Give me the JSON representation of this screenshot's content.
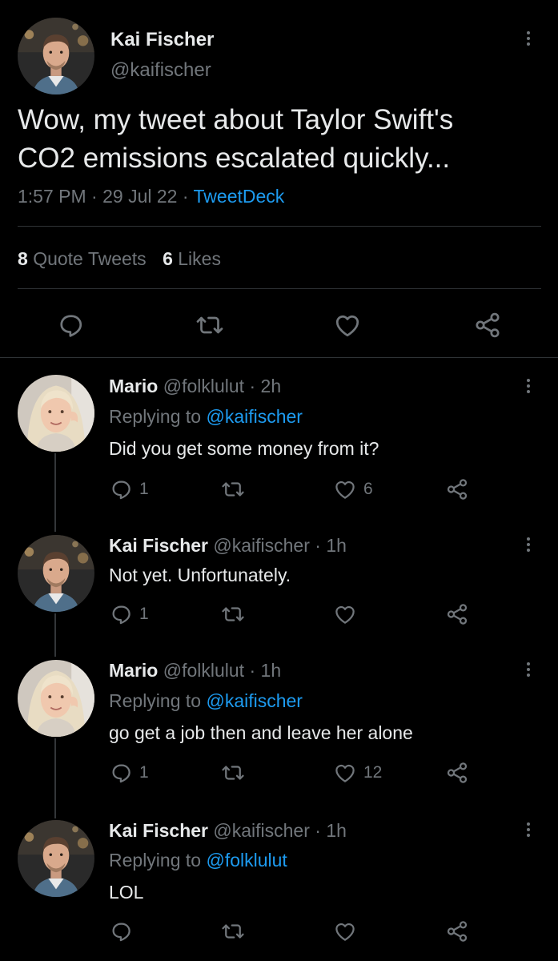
{
  "main_tweet": {
    "author_name": "Kai Fischer",
    "author_handle": "@kaifischer",
    "text_line1": "Wow, my tweet about Taylor Swift's",
    "text_line2": "CO2 emissions escalated quickly...",
    "time": "1:57 PM",
    "date": "29 Jul 22",
    "source": "TweetDeck",
    "quote_count": "8",
    "quote_label": "Quote Tweets",
    "like_count": "6",
    "like_label": "Likes"
  },
  "replies": [
    {
      "name": "Mario",
      "handle": "@folklulut",
      "time": "2h",
      "replying_prefix": "Replying to",
      "replying_to": "@kaifischer",
      "text": "Did you get some money from it?",
      "reply_count": "1",
      "like_count": "6"
    },
    {
      "name": "Kai Fischer",
      "handle": "@kaifischer",
      "time": "1h",
      "text": "Not yet. Unfortunately.",
      "reply_count": "1",
      "like_count": ""
    },
    {
      "name": "Mario",
      "handle": "@folklulut",
      "time": "1h",
      "replying_prefix": "Replying to",
      "replying_to": "@kaifischer",
      "text": "go get a job then and leave her alone",
      "reply_count": "1",
      "like_count": "12"
    },
    {
      "name": "Kai Fischer",
      "handle": "@kaifischer",
      "time": "1h",
      "replying_prefix": "Replying to",
      "replying_to": "@folklulut",
      "text": "LOL",
      "reply_count": "",
      "like_count": ""
    }
  ],
  "separators": {
    "dot": "·"
  },
  "colors": {
    "background": "#000000",
    "text": "#e7e9ea",
    "muted": "#71767b",
    "link": "#1d9bf0",
    "divider": "#2f3336"
  }
}
